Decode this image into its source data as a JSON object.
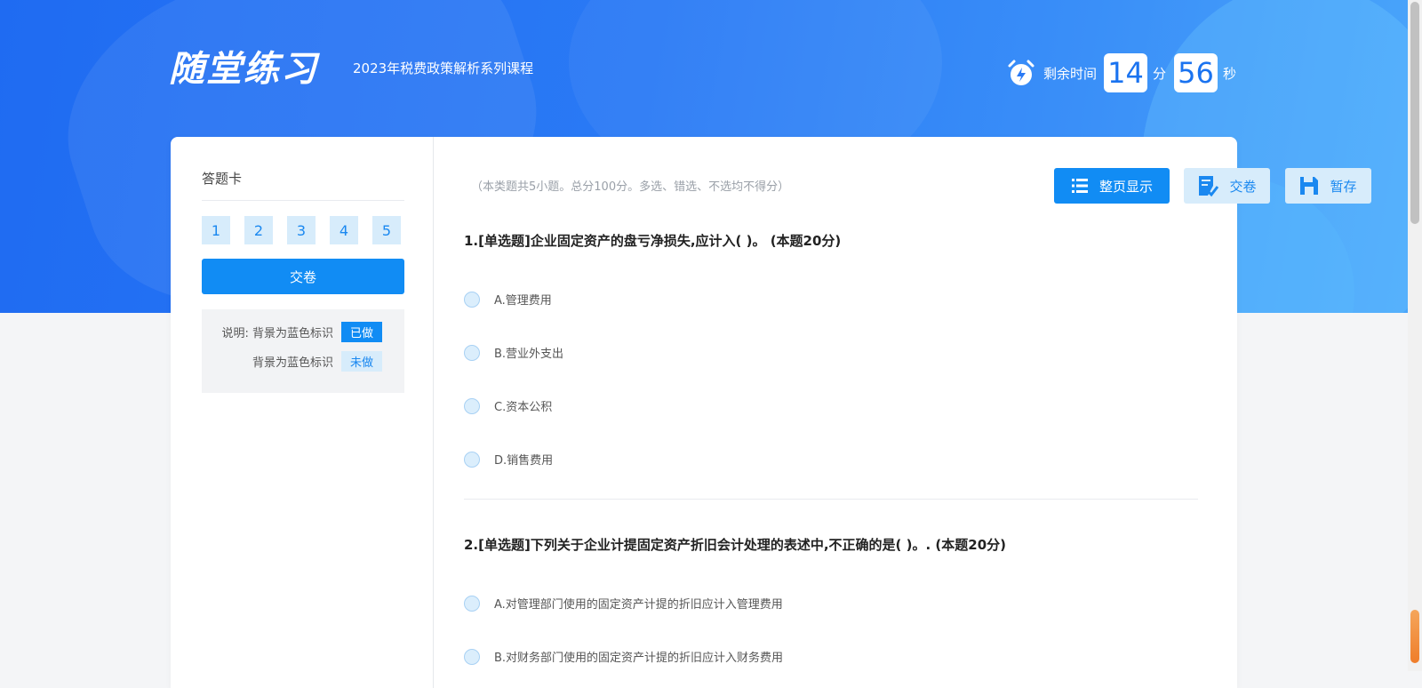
{
  "header": {
    "logo_text": "随堂练习",
    "course_title": "2023年税费政策解析系列课程",
    "timer_label": "剩余时间",
    "minutes": "14",
    "minutes_unit": "分",
    "seconds": "56",
    "seconds_unit": "秒"
  },
  "sidebar": {
    "title": "答题卡",
    "numbers": [
      "1",
      "2",
      "3",
      "4",
      "5"
    ],
    "submit_label": "交卷",
    "legend": {
      "line1": "说明: 背景为蓝色标识",
      "tag_done": "已做",
      "line2": "背景为蓝色标识",
      "tag_todo": "未做"
    }
  },
  "toolbar": {
    "hint": "（本类题共5小题。总分100分。多选、错选、不选均不得分）",
    "page_view_label": "整页显示",
    "submit_label": "交卷",
    "save_label": "暂存"
  },
  "questions": [
    {
      "title": "1.[单选题]企业固定资产的盘亏净损失,应计入( )。 (本题20分)",
      "options": [
        "A.管理费用",
        "B.营业外支出",
        "C.资本公积",
        "D.销售费用"
      ]
    },
    {
      "title": "2.[单选题]下列关于企业计提固定资产折旧会计处理的表述中,不正确的是( )。. (本题20分)",
      "options": [
        "A.对管理部门使用的固定资产计提的折旧应计入管理费用",
        "B.对财务部门使用的固定资产计提的折旧应计入财务费用"
      ]
    }
  ],
  "colors": {
    "accent": "#118cf4",
    "accent_light": "#d7ecfb",
    "header_blue": "#2a7af5"
  },
  "icons": {
    "timer": "alarm-clock-icon",
    "page_view": "list-icon",
    "submit": "paper-check-icon",
    "save": "floppy-disk-icon"
  }
}
